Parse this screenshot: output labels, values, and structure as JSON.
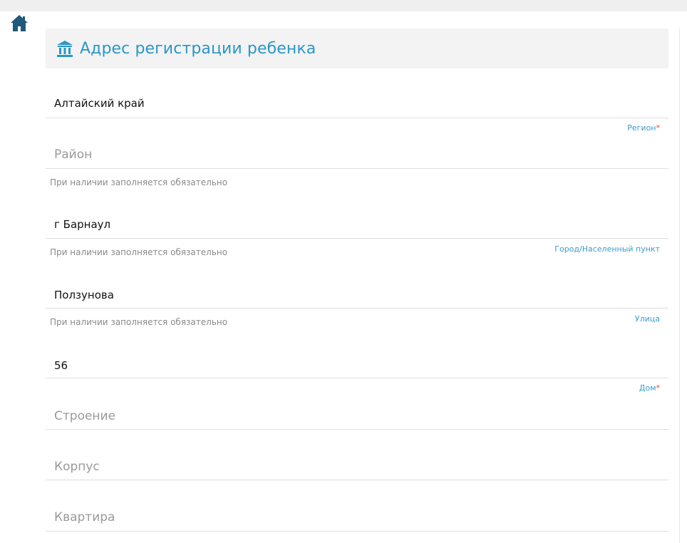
{
  "form": {
    "section_title": "Адрес регистрации ребенка",
    "fields": {
      "region": {
        "value": "Алтайский край",
        "label": "Регион",
        "required_mark": "*"
      },
      "district": {
        "placeholder": "Район",
        "hint": "При наличии заполняется обязательно"
      },
      "city": {
        "value": "г Барнаул",
        "label": "Город/Населенный пункт",
        "hint": "При наличии заполняется обязательно"
      },
      "street": {
        "value": "Ползунова",
        "label": "Улица",
        "hint": "При наличии заполняется обязательно"
      },
      "house": {
        "value": "56",
        "label": "Дом",
        "required_mark": "*"
      },
      "building": {
        "placeholder": "Строение"
      },
      "block": {
        "placeholder": "Корпус"
      },
      "apartment": {
        "placeholder": "Квартира"
      }
    }
  },
  "colors": {
    "accent": "#2a97c7",
    "label": "#3a9bd0",
    "required": "#e04040",
    "home_icon": "#1f5a7a"
  },
  "icons": {
    "home": "home-icon",
    "section": "bank-icon"
  }
}
